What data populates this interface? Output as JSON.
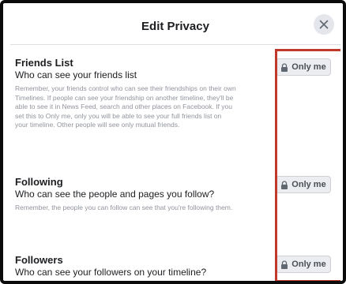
{
  "dialog": {
    "title": "Edit Privacy",
    "close_icon": "close-icon"
  },
  "sections": [
    {
      "title": "Friends List",
      "question": "Who can see your friends list",
      "description": "Remember, your friends control who can see their friendships on their own Timelines. If people can see your friendship on another timeline, they'll be able to see it in News Feed, search and other places on Facebook. If you set this to Only me, only you will be able to see your full friends list on your timeline. Other people will see only mutual friends.",
      "privacy_label": "Only me",
      "privacy_icon": "lock-icon"
    },
    {
      "title": "Following",
      "question": "Who can see the people and pages you follow?",
      "description": "Remember, the people you can follow can see that you're following them.",
      "privacy_label": "Only me",
      "privacy_icon": "lock-icon"
    },
    {
      "title": "Followers",
      "question": "Who can see your followers on your timeline?",
      "description": "",
      "privacy_label": "Only me",
      "privacy_icon": "lock-icon"
    }
  ],
  "colors": {
    "highlight_box": "#c0392b",
    "button_bg": "#ebedf0",
    "description_text": "#90949c"
  }
}
